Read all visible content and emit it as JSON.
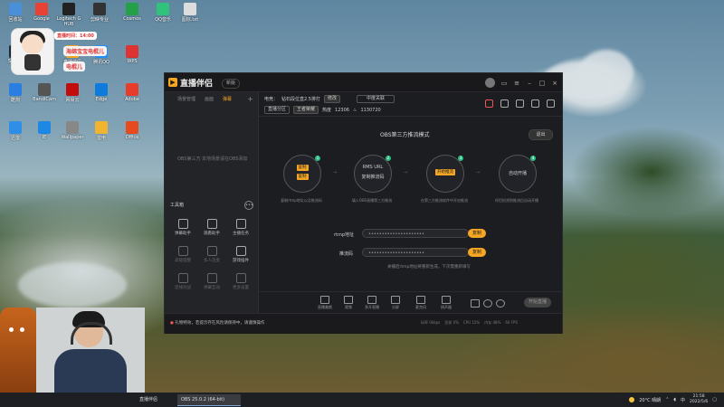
{
  "desktop": {
    "icons": [
      {
        "label": "回收站",
        "color": "#4a90d9"
      },
      {
        "label": "Google",
        "color": "#e94235"
      },
      {
        "label": "Logitech G HUB",
        "color": "#222"
      },
      {
        "label": "剪映专业",
        "color": "#333"
      },
      {
        "label": "Cosmos",
        "color": "#24a148"
      },
      {
        "label": "QQ音乐",
        "color": "#31c27c"
      },
      {
        "label": "图标.txt",
        "color": "#ddd"
      },
      {
        "label": "Steam",
        "color": "#1b2838"
      },
      {
        "label": "XSplit",
        "color": "#2f6fb3"
      },
      {
        "label": "直播伴侣",
        "color": "#f5a623"
      },
      {
        "label": "腾讯QQ",
        "color": "#1e90ff"
      },
      {
        "label": "WPS",
        "color": "#d33"
      },
      {
        "label": "酷狗",
        "color": "#2a7de1"
      },
      {
        "label": "BandiCam",
        "color": "#555"
      },
      {
        "label": "网易云",
        "color": "#c20c0c"
      },
      {
        "label": "Edge",
        "color": "#0c7bdc"
      },
      {
        "label": "Adobe",
        "color": "#e83c2b"
      },
      {
        "label": "迅雷",
        "color": "#2f8ee6"
      },
      {
        "label": "IE",
        "color": "#1e88e5"
      },
      {
        "label": "Wallpaper",
        "color": "#888"
      },
      {
        "label": "雷电",
        "color": "#f2b430"
      },
      {
        "label": "Office",
        "color": "#e84a1f"
      }
    ]
  },
  "overlay": {
    "badge_time": "直播时间：14:00",
    "badge_name1": "海绵宝宝电棍儿",
    "badge_name2": "电棍儿"
  },
  "app": {
    "name": "直播伴侣",
    "version": "新版",
    "left_tabs": [
      "场景管理",
      "画面",
      "弹幕"
    ],
    "left_tab_add": "+",
    "left_empty_text": "OBS第三方 本地场景请在OBS添加",
    "toolbox_title": "工具箱",
    "tools": [
      {
        "label": "弹幕助手",
        "dim": false
      },
      {
        "label": "观看助手",
        "dim": false
      },
      {
        "label": "主播任务",
        "dim": false
      },
      {
        "label": "高能提醒",
        "dim": true
      },
      {
        "label": "多人连麦",
        "dim": true
      },
      {
        "label": "游戏插件",
        "dim": false
      },
      {
        "label": "连线对战",
        "dim": true
      },
      {
        "label": "弹幕互动",
        "dim": true
      },
      {
        "label": "更多设置",
        "dim": true
      }
    ],
    "header": {
      "channel_label": "电竞：",
      "channel_value": "钻石段位直2.5排打",
      "edit_label": "修改",
      "mode_pill": "中度关联",
      "category_label": "直播分区",
      "category_value": "王者荣耀",
      "tag_label": "热度",
      "stat1": "12306",
      "stat2": "1130720"
    },
    "obs_mode_title": "OBS第三方推流模式",
    "exit_label": "退出",
    "steps": [
      {
        "num": "1",
        "btn1": "复制",
        "btn2": "复制",
        "caption": "复制rtmp地址以及推流码"
      },
      {
        "num": "2",
        "line1": "RMS URL",
        "line2": "复制推流码",
        "caption": "填入OBS直播第三方推流"
      },
      {
        "num": "3",
        "btn1": "开始推流",
        "caption": "在第三方推流软件中开启推流"
      },
      {
        "num": "4",
        "line1": "自动开播",
        "caption": "伴侣检测到推流后自动开播"
      }
    ],
    "rtmp_label": "rtmp地址",
    "rtmp_value": "•••••••••••••••••••••",
    "key_label": "推流码",
    "key_value": "•••••••••••••••••••••",
    "copy_label": "复制",
    "hint": "关播后rtmp地址将重新生成，下次需重新填写",
    "bottom_tools": [
      "直播美颜",
      "视频",
      "多开直播",
      "分屏",
      "麦克风",
      "扬声器"
    ],
    "start_live": "开始直播",
    "status_warn": "礼物特效，若提示存在风险请保持中，请谨慎操作",
    "status_stats": [
      "码率 0kbps",
      "丢帧 0%",
      "CPU 15%",
      "内存 48%",
      "60 FPS"
    ]
  },
  "taskbar": {
    "obs_item": "OBS 25.0.2 (64-bit)",
    "live_item": "直播伴侣",
    "weather": "20°C 晴朗",
    "time": "21:58",
    "date": "2022/5/6"
  }
}
